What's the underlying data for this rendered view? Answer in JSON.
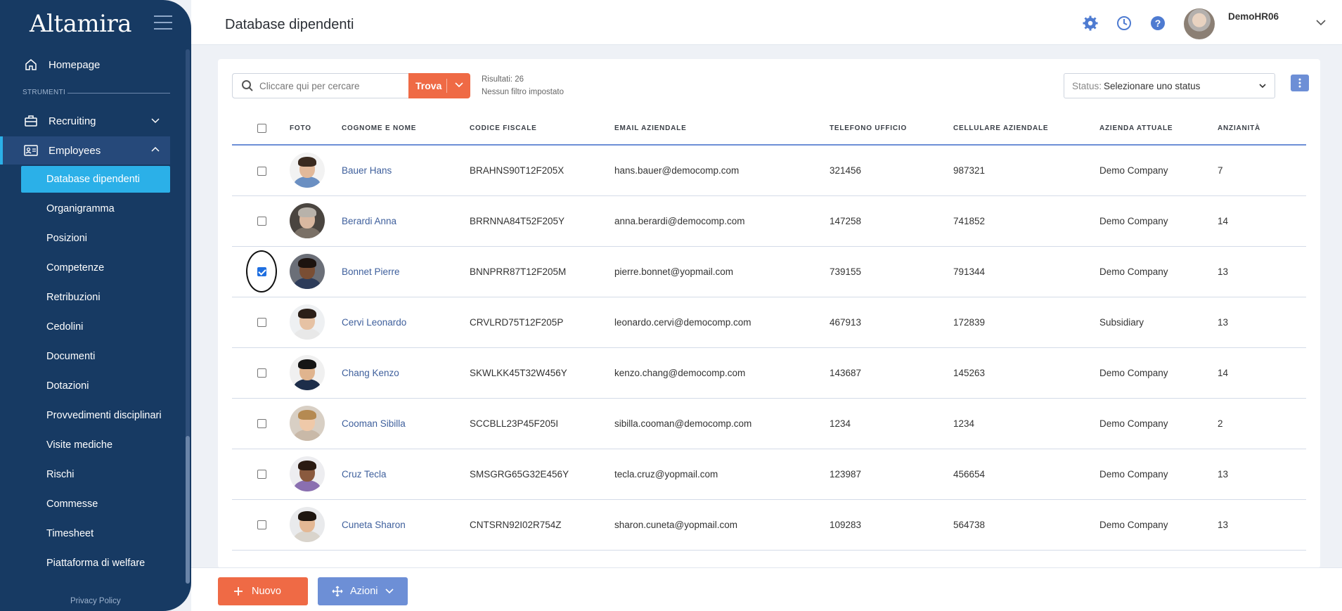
{
  "app": {
    "logo": "Altamira"
  },
  "sidebar": {
    "section_label": "STRUMENTI",
    "homepage": "Homepage",
    "recruiting": "Recruiting",
    "employees": "Employees",
    "items": [
      "Database dipendenti",
      "Organigramma",
      "Posizioni",
      "Competenze",
      "Retribuzioni",
      "Cedolini",
      "Documenti",
      "Dotazioni",
      "Provvedimenti disciplinari",
      "Visite mediche",
      "Rischi",
      "Commesse",
      "Timesheet",
      "Piattaforma di welfare"
    ],
    "privacy": "Privacy Policy"
  },
  "header": {
    "title": "Database dipendenti",
    "user": "DemoHR06"
  },
  "toolbar": {
    "search_placeholder": "Cliccare qui per cercare",
    "search_button": "Trova",
    "results_line1": "Risultati: 26",
    "results_line2": "Nessun filtro impostato",
    "status_label": "Status:",
    "status_value": "Selezionare uno status"
  },
  "table": {
    "columns": [
      "FOTO",
      "COGNOME E NOME",
      "CODICE FISCALE",
      "EMAIL AZIENDALE",
      "TELEFONO UFFICIO",
      "CELLULARE AZIENDALE",
      "AZIENDA ATTUALE",
      "ANZIANITÀ"
    ],
    "rows": [
      {
        "name": "Bauer Hans",
        "cf": "BRAHNS90T12F205X",
        "email": "hans.bauer@democomp.com",
        "tel": "321456",
        "cell": "987321",
        "company": "Demo Company",
        "years": "7",
        "checked": false
      },
      {
        "name": "Berardi Anna",
        "cf": "BRRNNA84T52F205Y",
        "email": "anna.berardi@democomp.com",
        "tel": "147258",
        "cell": "741852",
        "company": "Demo Company",
        "years": "14",
        "checked": false
      },
      {
        "name": "Bonnet Pierre",
        "cf": "BNNPRR87T12F205M",
        "email": "pierre.bonnet@yopmail.com",
        "tel": "739155",
        "cell": "791344",
        "company": "Demo Company",
        "years": "13",
        "checked": true
      },
      {
        "name": "Cervi Leonardo",
        "cf": "CRVLRD75T12F205P",
        "email": "leonardo.cervi@democomp.com",
        "tel": "467913",
        "cell": "172839",
        "company": "Subsidiary",
        "years": "13",
        "checked": false
      },
      {
        "name": "Chang Kenzo",
        "cf": "SKWLKK45T32W456Y",
        "email": "kenzo.chang@democomp.com",
        "tel": "143687",
        "cell": "145263",
        "company": "Demo Company",
        "years": "14",
        "checked": false
      },
      {
        "name": "Cooman Sibilla",
        "cf": "SCCBLL23P45F205I",
        "email": "sibilla.cooman@democomp.com",
        "tel": "1234",
        "cell": "1234",
        "company": "Demo Company",
        "years": "2",
        "checked": false
      },
      {
        "name": "Cruz Tecla",
        "cf": "SMSGRG65G32E456Y",
        "email": "tecla.cruz@yopmail.com",
        "tel": "123987",
        "cell": "456654",
        "company": "Demo Company",
        "years": "13",
        "checked": false
      },
      {
        "name": "Cuneta Sharon",
        "cf": "CNTSRN92I02R754Z",
        "email": "sharon.cuneta@yopmail.com",
        "tel": "109283",
        "cell": "564738",
        "company": "Demo Company",
        "years": "13",
        "checked": false
      }
    ]
  },
  "footer": {
    "new_button": "Nuovo",
    "actions_button": "Azioni"
  },
  "colors": {
    "sidebar_bg": "#173a63",
    "active_blue": "#2bb0e8",
    "accent_orange": "#ef6a45",
    "accent_blue": "#6d8fd6",
    "link": "#3e5f9c"
  },
  "icons": [
    "home-icon",
    "briefcase-icon",
    "id-card-icon",
    "gear-icon",
    "clock-icon",
    "help-icon",
    "search-icon",
    "plus-icon",
    "move-icon",
    "kebab-icon"
  ]
}
